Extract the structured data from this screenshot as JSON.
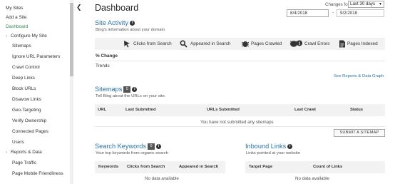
{
  "sidebar": {
    "items": [
      {
        "label": "My Sites",
        "level": "top"
      },
      {
        "label": "Add a Site",
        "level": "top"
      },
      {
        "label": "Dashboard",
        "level": "top",
        "active": true
      },
      {
        "label": "Configure My Site",
        "level": "group"
      },
      {
        "label": "Sitemaps",
        "level": "sub"
      },
      {
        "label": "Ignore URL Parameters",
        "level": "sub"
      },
      {
        "label": "Crawl Control",
        "level": "sub"
      },
      {
        "label": "Deep Links",
        "level": "sub"
      },
      {
        "label": "Block URLs",
        "level": "sub"
      },
      {
        "label": "Disavow Links",
        "level": "sub"
      },
      {
        "label": "Geo-Targeting",
        "level": "sub"
      },
      {
        "label": "Verify Ownership",
        "level": "sub"
      },
      {
        "label": "Connected Pages",
        "level": "sub"
      },
      {
        "label": "Users",
        "level": "sub"
      },
      {
        "label": "Reports & Data",
        "level": "group"
      },
      {
        "label": "Page Traffic",
        "level": "sub"
      },
      {
        "label": "Page Mobile Friendliness",
        "level": "sub"
      }
    ],
    "collapse_arrow": "❮"
  },
  "header": {
    "title": "Dashboard",
    "changes_label": "Changes for",
    "period_value": "Last 30 days",
    "date_from": "8/4/2018",
    "date_sep": "-",
    "date_to": "9/2/2018"
  },
  "site_activity": {
    "title": "Site Activity",
    "description": "Bing's information about your domain",
    "metrics": [
      {
        "label": "Clicks from Search",
        "icon": "cursor-icon"
      },
      {
        "label": "Appeared in Search",
        "icon": "search-icon"
      },
      {
        "label": "Pages Crawled",
        "icon": "crawler-icon"
      },
      {
        "label": "Crawl Errors",
        "icon": "crawl-errors-icon"
      },
      {
        "label": "Pages Indexed",
        "icon": "document-icon"
      }
    ],
    "row_change": "% Change",
    "row_trends": "Trends",
    "link": "See Reports & Data Graph"
  },
  "sitemaps": {
    "title": "Sitemaps",
    "count": "0",
    "description": "Tell Bing about the URLs on your site.",
    "columns": [
      "URL",
      "Last Submitted",
      "URLs Submitted",
      "Last Crawl",
      "Status"
    ],
    "empty_message": "You have not submitted any sitemaps",
    "button": "SUBMIT A SITEMAP"
  },
  "search_keywords": {
    "title": "Search Keywords",
    "count": "0",
    "description": "Your top keywords from organic search",
    "columns": [
      "Keywords",
      "Clicks from Search",
      "Appeared in Search"
    ],
    "empty_message": "No data available"
  },
  "inbound_links": {
    "title": "Inbound Links",
    "description": "Links pointed at your website",
    "columns": [
      "Target Page",
      "Count of Links"
    ],
    "empty_message": "No data available"
  },
  "colors": {
    "accent": "#2b72a6",
    "active_nav": "#2c8b4d",
    "header_bg": "#f2f2f2"
  }
}
